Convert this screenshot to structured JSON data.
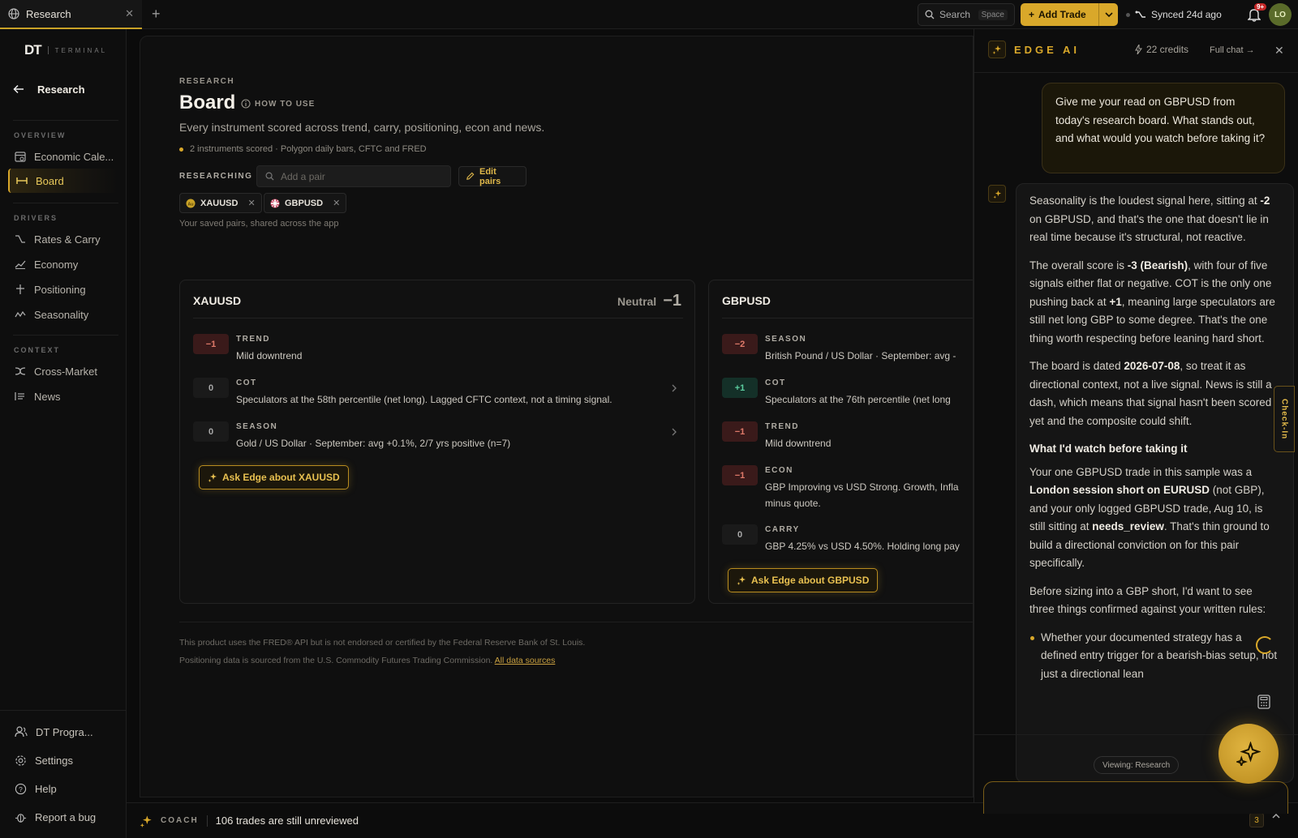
{
  "tab": {
    "title": "Research"
  },
  "topbar": {
    "search_label": "Search",
    "search_kbd": "Space",
    "add_trade_label": "Add Trade",
    "synced_label": "Synced 24d ago",
    "notif_badge": "9+",
    "avatar_initials": "LO"
  },
  "sidebar": {
    "logo": "DT",
    "logo_sub": "TERMINAL",
    "back_label": "Research",
    "overview_heading": "OVERVIEW",
    "drivers_heading": "DRIVERS",
    "context_heading": "CONTEXT",
    "overview": [
      {
        "label": "Economic Cale...",
        "icon": "calendar-icon"
      },
      {
        "label": "Board",
        "icon": "board-icon",
        "active": true
      }
    ],
    "drivers": [
      {
        "label": "Rates & Carry",
        "icon": "rates-icon"
      },
      {
        "label": "Economy",
        "icon": "economy-icon"
      },
      {
        "label": "Positioning",
        "icon": "positioning-icon"
      },
      {
        "label": "Seasonality",
        "icon": "seasonality-icon"
      }
    ],
    "context": [
      {
        "label": "Cross-Market",
        "icon": "cross-market-icon"
      },
      {
        "label": "News",
        "icon": "news-icon"
      }
    ],
    "bottom": [
      {
        "label": "DT Progra...",
        "icon": "users-icon"
      },
      {
        "label": "Settings",
        "icon": "gear-icon"
      },
      {
        "label": "Help",
        "icon": "help-icon"
      },
      {
        "label": "Report a bug",
        "icon": "bug-icon"
      }
    ]
  },
  "main": {
    "crumb": "RESEARCH",
    "title": "Board",
    "how_to_use": "HOW TO USE",
    "subtitle": "Every instrument scored across trend, carry, positioning, econ and news.",
    "meta": "2 instruments scored · Polygon daily bars, CFTC and FRED",
    "researching_label": "RESEARCHING",
    "pair_placeholder": "Add a pair",
    "edit_pairs": "Edit pairs",
    "chips": [
      "XAUUSD",
      "GBPUSD"
    ],
    "saved_note": "Your saved pairs, shared across the app",
    "footer1": "This product uses the FRED® API but is not endorsed or certified by the Federal Reserve Bank of St. Louis.",
    "footer2": "Positioning data is sourced from the U.S. Commodity Futures Trading Commission.",
    "footer2_link": "All data sources"
  },
  "cards": [
    {
      "pair": "XAUUSD",
      "bias": "Neutral",
      "score": "−1",
      "ask": "Ask Edge about XAUUSD",
      "signals": [
        {
          "score": "−1",
          "tone": "neg",
          "label": "TREND",
          "desc": "Mild downtrend"
        },
        {
          "score": "0",
          "tone": "zero",
          "label": "COT",
          "desc": "Speculators at the 58th percentile (net long). Lagged CFTC context, not a timing signal."
        },
        {
          "score": "0",
          "tone": "zero",
          "label": "SEASON",
          "desc": "Gold / US Dollar · September: avg +0.1%, 2/7 yrs positive (n=7)"
        }
      ]
    },
    {
      "pair": "GBPUSD",
      "ask": "Ask Edge about GBPUSD",
      "signals": [
        {
          "score": "−2",
          "tone": "neg",
          "label": "SEASON",
          "desc": "British Pound / US Dollar · September: avg -"
        },
        {
          "score": "+1",
          "tone": "pos",
          "label": "COT",
          "desc": "Speculators at the 76th percentile (net long"
        },
        {
          "score": "−1",
          "tone": "neg",
          "label": "TREND",
          "desc": "Mild downtrend"
        },
        {
          "score": "−1",
          "tone": "neg",
          "label": "ECON",
          "desc": "GBP Improving vs USD Strong. Growth, Infla",
          "desc2": "minus quote."
        },
        {
          "score": "0",
          "tone": "zero",
          "label": "CARRY",
          "desc": "GBP 4.25% vs USD 4.50%. Holding long pay"
        }
      ]
    }
  ],
  "coach": {
    "label": "COACH",
    "message": "106 trades are still unreviewed",
    "count": "3"
  },
  "chat": {
    "title": "EDGE AI",
    "credits": "22 credits",
    "full_chat": "Full chat →",
    "user_msg": "Give me your read on GBPUSD from today's research board. What stands out, and what would you watch before taking it?",
    "p1_a": "Seasonality is the loudest signal here, sitting at ",
    "p1_b": "-2",
    "p1_c": " on GBPUSD, and that's the one that doesn't lie in real time because it's structural, not reactive.",
    "p2_a": "The overall score is ",
    "p2_b": "-3 (Bearish)",
    "p2_c": ", with four of five signals either flat or negative. COT is the only one pushing back at ",
    "p2_d": "+1",
    "p2_e": ", meaning large speculators are still net long GBP to some degree. That's the one thing worth respecting before leaning hard short.",
    "p3_a": "The board is dated ",
    "p3_b": "2026-07-08",
    "p3_c": ", so treat it as directional context, not a live signal. News is still a dash, which means that signal hasn't been scored yet and the composite could shift.",
    "h_watch": "What I'd watch before taking it",
    "p4_a": "Your one GBPUSD trade in this sample was a ",
    "p4_b": "London session short on EURUSD",
    "p4_c": " (not GBP), and your only logged GBPUSD trade, Aug 10, is still sitting at ",
    "p4_d": "needs_review",
    "p4_e": ". That's thin ground to build a directional conviction on for this pair specifically.",
    "p5": "Before sizing into a GBP short, I'd want to see three things confirmed against your written rules:",
    "bullet1": "Whether your documented strategy has a defined entry trigger for a bearish-bias setup, not just a directional lean",
    "check_in": "Check-In",
    "viewing": "Viewing: Research"
  },
  "colors": {
    "accent": "#d9a82a",
    "negative": "#e07a6a",
    "positive": "#5ccfa0"
  }
}
